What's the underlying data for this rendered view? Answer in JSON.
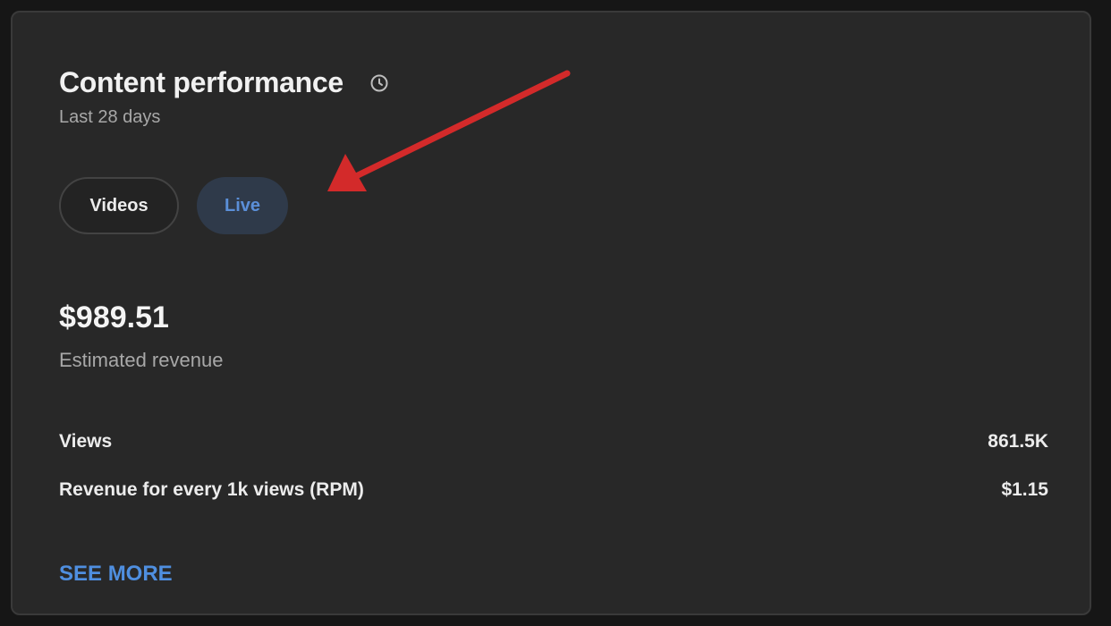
{
  "card": {
    "title": "Content performance",
    "title_icon": "clock-icon",
    "subtitle": "Last 28 days"
  },
  "tabs": [
    {
      "label": "Videos",
      "selected": false
    },
    {
      "label": "Live",
      "selected": true
    }
  ],
  "revenue": {
    "value": "$989.51",
    "label": "Estimated revenue"
  },
  "metrics": [
    {
      "label": "Views",
      "value": "861.5K"
    },
    {
      "label": "Revenue for every 1k views (RPM)",
      "value": "$1.15"
    }
  ],
  "see_more": "SEE MORE",
  "annotation": {
    "arrow_color": "#d32a2a"
  },
  "colors": {
    "card_bg": "#282828",
    "accent_blue": "#4f8fe0",
    "live_chip_bg": "#2f3a4a"
  }
}
